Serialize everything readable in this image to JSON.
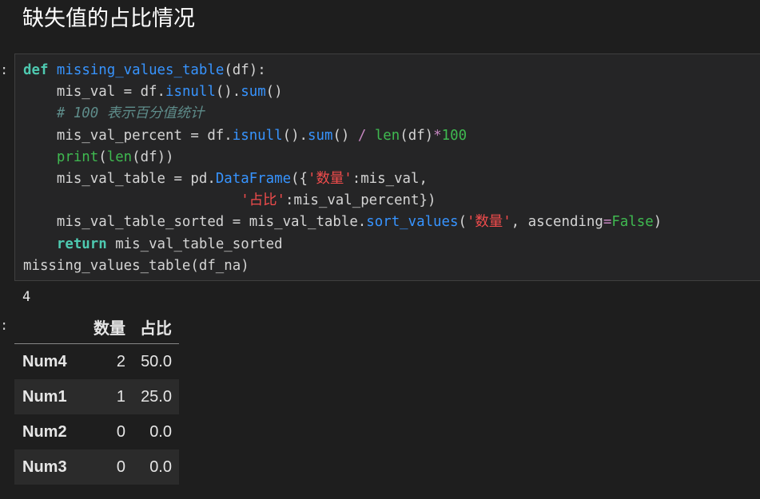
{
  "heading": "缺失值的占比情况",
  "prompts": {
    "code_cell": ":",
    "output_cell": ":"
  },
  "code_cell": {
    "lines": [
      [
        [
          "kw",
          "def"
        ],
        [
          "plain",
          " "
        ],
        [
          "fn",
          "missing_values_table"
        ],
        [
          "plain",
          "(df):"
        ]
      ],
      [
        [
          "plain",
          "    mis_val = df."
        ],
        [
          "fn",
          "isnull"
        ],
        [
          "plain",
          "()."
        ],
        [
          "fn",
          "sum"
        ],
        [
          "plain",
          "()"
        ]
      ],
      [
        [
          "plain",
          "    "
        ],
        [
          "cm",
          "# 100 表示百分值统计"
        ]
      ],
      [
        [
          "plain",
          "    mis_val_percent = df."
        ],
        [
          "fn",
          "isnull"
        ],
        [
          "plain",
          "()."
        ],
        [
          "fn",
          "sum"
        ],
        [
          "plain",
          "() "
        ],
        [
          "op",
          "/"
        ],
        [
          "plain",
          " "
        ],
        [
          "kw2",
          "len"
        ],
        [
          "plain",
          "(df)"
        ],
        [
          "op",
          "*"
        ],
        [
          "num",
          "100"
        ]
      ],
      [
        [
          "plain",
          "    "
        ],
        [
          "kw2",
          "print"
        ],
        [
          "plain",
          "("
        ],
        [
          "kw2",
          "len"
        ],
        [
          "plain",
          "(df))"
        ]
      ],
      [
        [
          "plain",
          "    mis_val_table = pd."
        ],
        [
          "fn",
          "DataFrame"
        ],
        [
          "plain",
          "({"
        ],
        [
          "str",
          "'数量'"
        ],
        [
          "plain",
          ":mis_val,"
        ]
      ],
      [
        [
          "plain",
          "                          "
        ],
        [
          "str",
          "'占比'"
        ],
        [
          "plain",
          ":mis_val_percent})"
        ]
      ],
      [
        [
          "plain",
          "    mis_val_table_sorted = mis_val_table."
        ],
        [
          "fn",
          "sort_values"
        ],
        [
          "plain",
          "("
        ],
        [
          "str",
          "'数量'"
        ],
        [
          "plain",
          ", ascending"
        ],
        [
          "op",
          "="
        ],
        [
          "bool",
          "False"
        ],
        [
          "plain",
          ")"
        ]
      ],
      [
        [
          "plain",
          "    "
        ],
        [
          "kw",
          "return"
        ],
        [
          "plain",
          " mis_val_table_sorted"
        ]
      ],
      [
        [
          "plain",
          "missing_values_table(df_na)"
        ]
      ]
    ]
  },
  "stdout": "4",
  "table": {
    "columns": [
      "数量",
      "占比"
    ],
    "rows": [
      {
        "index": "Num4",
        "count": "2",
        "pct": "50.0"
      },
      {
        "index": "Num1",
        "count": "1",
        "pct": "25.0"
      },
      {
        "index": "Num2",
        "count": "0",
        "pct": "0.0"
      },
      {
        "index": "Num3",
        "count": "0",
        "pct": "0.0"
      }
    ]
  }
}
